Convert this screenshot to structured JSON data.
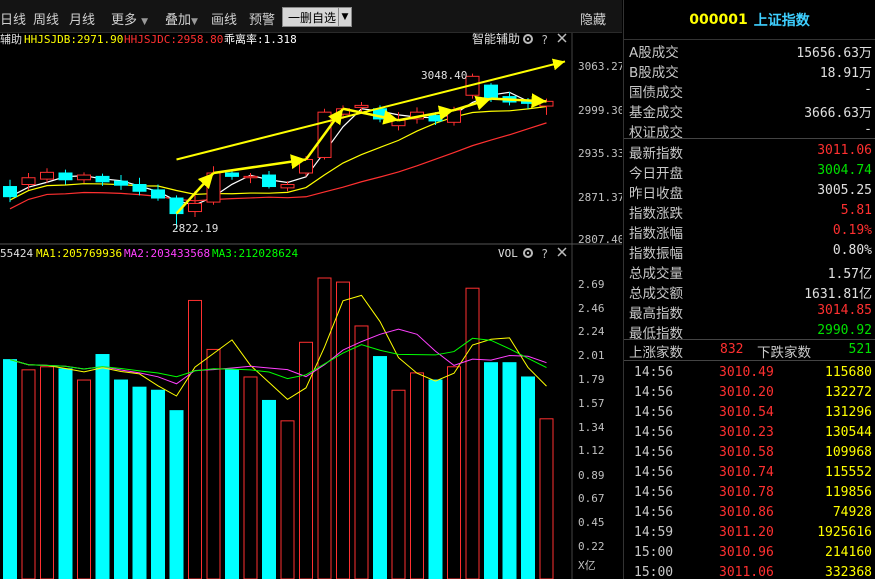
{
  "toolbar": {
    "items": [
      "日线",
      "周线",
      "月线",
      "更多",
      "叠加",
      "画线",
      "预警"
    ],
    "more_arrow": "▼",
    "overlay_arrow": "▼",
    "selected_label": "一删自选",
    "dropdown_arrow": "▼",
    "hide_label": "隐藏"
  },
  "price_panel": {
    "legend_prefix": "辅助",
    "legend_items": [
      {
        "text": "HHJSJDB:2971.90",
        "color": "#ffff00"
      },
      {
        "text": "HHJSJDC:2958.80",
        "color": "#ff3030"
      },
      {
        "text": "乖离率:1.318",
        "color": "#ffffff"
      }
    ],
    "assist_label": "智能辅助",
    "y_ticks": [
      "3063.27",
      "2999.30",
      "2935.33",
      "2871.37",
      "2807.40"
    ],
    "annotation_high": "3048.40",
    "annotation_low": "2822.19"
  },
  "volume_panel": {
    "legend_items": [
      {
        "text": "55424",
        "color": "#e0e0e0"
      },
      {
        "text": "MA1:205769936",
        "color": "#ffff00"
      },
      {
        "text": "MA2:203433568",
        "color": "#ff40ff"
      },
      {
        "text": "MA3:212028624",
        "color": "#00ff00"
      }
    ],
    "vol_label": "VOL",
    "y_ticks": [
      "2.69",
      "2.46",
      "2.24",
      "2.01",
      "1.79",
      "1.57",
      "1.34",
      "1.12",
      "0.89",
      "0.67",
      "0.45",
      "0.22"
    ],
    "unit": "X亿"
  },
  "colors": {
    "up": "#ff3030",
    "down": "#00ffff",
    "ma1": "#ffffff",
    "ma2": "#ffff00",
    "ma3": "#ff3030",
    "arrow": "#ffff00"
  },
  "quote": {
    "code": "000001",
    "name": "上证指数",
    "rows": [
      {
        "label": "A股成交",
        "value": "15656.63万",
        "color": "white"
      },
      {
        "label": "B股成交",
        "value": "18.91万",
        "color": "white"
      },
      {
        "label": "国债成交",
        "value": "-",
        "color": "white"
      },
      {
        "label": "基金成交",
        "value": "3666.63万",
        "color": "white"
      },
      {
        "label": "权证成交",
        "value": "-",
        "color": "white"
      },
      {
        "label": "最新指数",
        "value": "3011.06",
        "color": "red"
      },
      {
        "label": "今日开盘",
        "value": "3004.74",
        "color": "green"
      },
      {
        "label": "昨日收盘",
        "value": "3005.25",
        "color": "white"
      },
      {
        "label": "指数涨跌",
        "value": "5.81",
        "color": "red"
      },
      {
        "label": "指数涨幅",
        "value": "0.19%",
        "color": "red"
      },
      {
        "label": "指数振幅",
        "value": "0.80%",
        "color": "white"
      },
      {
        "label": "总成交量",
        "value": "1.57亿",
        "color": "white"
      },
      {
        "label": "总成交额",
        "value": "1631.81亿",
        "color": "white"
      },
      {
        "label": "最高指数",
        "value": "3014.85",
        "color": "red"
      },
      {
        "label": "最低指数",
        "value": "2990.92",
        "color": "green"
      }
    ],
    "advance_label": "上涨家数",
    "advance_value": "832",
    "decline_label": "下跌家数",
    "decline_value": "521"
  },
  "ticks": [
    {
      "time": "14:56",
      "price": "3010.49",
      "vol": "115680"
    },
    {
      "time": "14:56",
      "price": "3010.20",
      "vol": "132272"
    },
    {
      "time": "14:56",
      "price": "3010.54",
      "vol": "131296"
    },
    {
      "time": "14:56",
      "price": "3010.23",
      "vol": "130544"
    },
    {
      "time": "14:56",
      "price": "3010.58",
      "vol": "109968"
    },
    {
      "time": "14:56",
      "price": "3010.74",
      "vol": "115552"
    },
    {
      "time": "14:56",
      "price": "3010.78",
      "vol": "119856"
    },
    {
      "time": "14:56",
      "price": "3010.86",
      "vol": "74928"
    },
    {
      "time": "14:59",
      "price": "3011.20",
      "vol": "1925616"
    },
    {
      "time": "15:00",
      "price": "3010.96",
      "vol": "214160"
    },
    {
      "time": "15:00",
      "price": "3011.06",
      "vol": "332368"
    }
  ],
  "candles": [
    {
      "o": 2885,
      "c": 2870,
      "h": 2895,
      "l": 2862
    },
    {
      "o": 2888,
      "c": 2898,
      "h": 2905,
      "l": 2880
    },
    {
      "o": 2896,
      "c": 2906,
      "h": 2912,
      "l": 2890
    },
    {
      "o": 2905,
      "c": 2895,
      "h": 2910,
      "l": 2888
    },
    {
      "o": 2895,
      "c": 2902,
      "h": 2906,
      "l": 2890
    },
    {
      "o": 2900,
      "c": 2892,
      "h": 2904,
      "l": 2886
    },
    {
      "o": 2893,
      "c": 2887,
      "h": 2902,
      "l": 2880
    },
    {
      "o": 2888,
      "c": 2878,
      "h": 2898,
      "l": 2872
    },
    {
      "o": 2880,
      "c": 2868,
      "h": 2888,
      "l": 2864
    },
    {
      "o": 2868,
      "c": 2845,
      "h": 2872,
      "l": 2822
    },
    {
      "o": 2848,
      "c": 2860,
      "h": 2878,
      "l": 2840
    },
    {
      "o": 2862,
      "c": 2905,
      "h": 2915,
      "l": 2858
    },
    {
      "o": 2905,
      "c": 2900,
      "h": 2910,
      "l": 2895
    },
    {
      "o": 2898,
      "c": 2900,
      "h": 2905,
      "l": 2890
    },
    {
      "o": 2902,
      "c": 2885,
      "h": 2908,
      "l": 2882
    },
    {
      "o": 2883,
      "c": 2888,
      "h": 2893,
      "l": 2878
    },
    {
      "o": 2905,
      "c": 2925,
      "h": 2930,
      "l": 2900
    },
    {
      "o": 2928,
      "c": 2995,
      "h": 3000,
      "l": 2925
    },
    {
      "o": 2992,
      "c": 3000,
      "h": 3005,
      "l": 2985
    },
    {
      "o": 3002,
      "c": 3005,
      "h": 3010,
      "l": 2995
    },
    {
      "o": 3000,
      "c": 2985,
      "h": 3005,
      "l": 2980
    },
    {
      "o": 2975,
      "c": 2983,
      "h": 2995,
      "l": 2968
    },
    {
      "o": 2985,
      "c": 2995,
      "h": 3002,
      "l": 2978
    },
    {
      "o": 2990,
      "c": 2982,
      "h": 2995,
      "l": 2976
    },
    {
      "o": 2980,
      "c": 2998,
      "h": 3003,
      "l": 2975
    },
    {
      "o": 3020,
      "c": 3048,
      "h": 3052,
      "l": 3015
    },
    {
      "o": 3035,
      "c": 3015,
      "h": 3038,
      "l": 3010
    },
    {
      "o": 3018,
      "c": 3010,
      "h": 3025,
      "l": 3005
    },
    {
      "o": 3012,
      "c": 3008,
      "h": 3016,
      "l": 3000
    },
    {
      "o": 3004,
      "c": 3011,
      "h": 3015,
      "l": 2991
    }
  ],
  "volumes": [
    2.15,
    2.05,
    2.08,
    2.06,
    1.95,
    2.2,
    1.95,
    1.88,
    1.85,
    1.65,
    2.73,
    2.25,
    2.05,
    1.98,
    1.75,
    1.55,
    2.32,
    2.95,
    2.91,
    2.48,
    2.18,
    1.85,
    2.02,
    1.95,
    2.08,
    2.85,
    2.12,
    2.12,
    1.98,
    1.57
  ]
}
